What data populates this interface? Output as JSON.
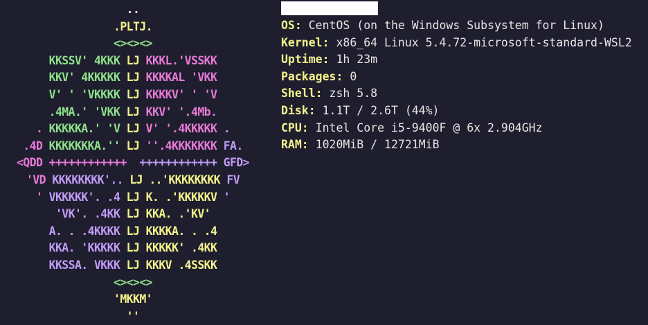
{
  "window": {
    "hostname_redacted": true
  },
  "logo": [
    [
      {
        "c": "w",
        "t": ".."
      }
    ],
    [
      {
        "c": "y",
        "t": ".PLTJ."
      }
    ],
    [
      {
        "c": "g",
        "t": "<><><>"
      }
    ],
    [
      {
        "c": "g",
        "t": "KKSSV' 4KKK "
      },
      {
        "c": "y",
        "t": "LJ "
      },
      {
        "c": "p",
        "t": "KKKL.'VSSKK"
      }
    ],
    [
      {
        "c": "g",
        "t": "KKV' 4KKKKK "
      },
      {
        "c": "y",
        "t": "LJ "
      },
      {
        "c": "p",
        "t": "KKKKAL 'VKK"
      }
    ],
    [
      {
        "c": "g",
        "t": "V' ' 'VKKKK "
      },
      {
        "c": "y",
        "t": "LJ "
      },
      {
        "c": "p",
        "t": "KKKKV' ' 'V"
      }
    ],
    [
      {
        "c": "g",
        "t": ".4MA.' 'VKK "
      },
      {
        "c": "y",
        "t": "LJ "
      },
      {
        "c": "p",
        "t": "KKV' '.4Mb."
      }
    ],
    [
      {
        "c": "p",
        "t": ". "
      },
      {
        "c": "g",
        "t": "KKKKKA.' 'V "
      },
      {
        "c": "y",
        "t": "LJ "
      },
      {
        "c": "p",
        "t": "V' '.4KKKKK "
      },
      {
        "c": "v",
        "t": "."
      }
    ],
    [
      {
        "c": "p",
        "t": ".4D "
      },
      {
        "c": "g",
        "t": "KKKKKKKA.'' "
      },
      {
        "c": "y",
        "t": "LJ "
      },
      {
        "c": "p",
        "t": "''.4KKKKKKK "
      },
      {
        "c": "v",
        "t": "FA."
      }
    ],
    [
      {
        "c": "p",
        "t": "<QDD "
      },
      {
        "c": "p",
        "t": "++++++++++++  "
      },
      {
        "c": "v",
        "t": "++++++++++++ GFD>"
      }
    ],
    [
      {
        "c": "p",
        "t": "'VD "
      },
      {
        "c": "v",
        "t": "KKKKKKKK'.. "
      },
      {
        "c": "y",
        "t": "LJ "
      },
      {
        "c": "y",
        "t": "..'KKKKKKKK "
      },
      {
        "c": "v",
        "t": "FV"
      }
    ],
    [
      {
        "c": "p",
        "t": "' "
      },
      {
        "c": "v",
        "t": "VKKKKK'. .4 "
      },
      {
        "c": "y",
        "t": "LJ "
      },
      {
        "c": "y",
        "t": "K. .'KKKKKV "
      },
      {
        "c": "v",
        "t": "'"
      }
    ],
    [
      {
        "c": "v",
        "t": "'VK'. .4KK "
      },
      {
        "c": "y",
        "t": "LJ "
      },
      {
        "c": "y",
        "t": "KKA. .'KV'"
      }
    ],
    [
      {
        "c": "v",
        "t": "A. . .4KKKK "
      },
      {
        "c": "y",
        "t": "LJ "
      },
      {
        "c": "y",
        "t": "KKKKA. . .4"
      }
    ],
    [
      {
        "c": "v",
        "t": "KKA. 'KKKKK "
      },
      {
        "c": "y",
        "t": "LJ "
      },
      {
        "c": "y",
        "t": "KKKKK' .4KK"
      }
    ],
    [
      {
        "c": "v",
        "t": "KKSSA. VKKK "
      },
      {
        "c": "y",
        "t": "LJ "
      },
      {
        "c": "y",
        "t": "KKKV .4SSKK"
      }
    ],
    [
      {
        "c": "g",
        "t": "<><><>"
      }
    ],
    [
      {
        "c": "y",
        "t": "'MKKM'"
      }
    ],
    [
      {
        "c": "y",
        "t": "''"
      }
    ]
  ],
  "info": [
    {
      "key": "OS:",
      "value": "CentOS (on the Windows Subsystem for Linux)"
    },
    {
      "key": "Kernel:",
      "value": "x86_64 Linux 5.4.72-microsoft-standard-WSL2"
    },
    {
      "key": "Uptime:",
      "value": "1h 23m"
    },
    {
      "key": "Packages:",
      "value": "0"
    },
    {
      "key": "Shell:",
      "value": "zsh 5.8"
    },
    {
      "key": "Disk:",
      "value": "1.1T / 2.6T (44%)"
    },
    {
      "key": "CPU:",
      "value": "Intel Core i5-9400F @ 6x 2.904GHz"
    },
    {
      "key": "RAM:",
      "value": "1020MiB / 12721MiB"
    }
  ],
  "colors": {
    "background": "#1e1e2e",
    "green": "#8ee08a",
    "yellow": "#f4f28c",
    "pink": "#e77ad6",
    "violet": "#c09bf5"
  }
}
